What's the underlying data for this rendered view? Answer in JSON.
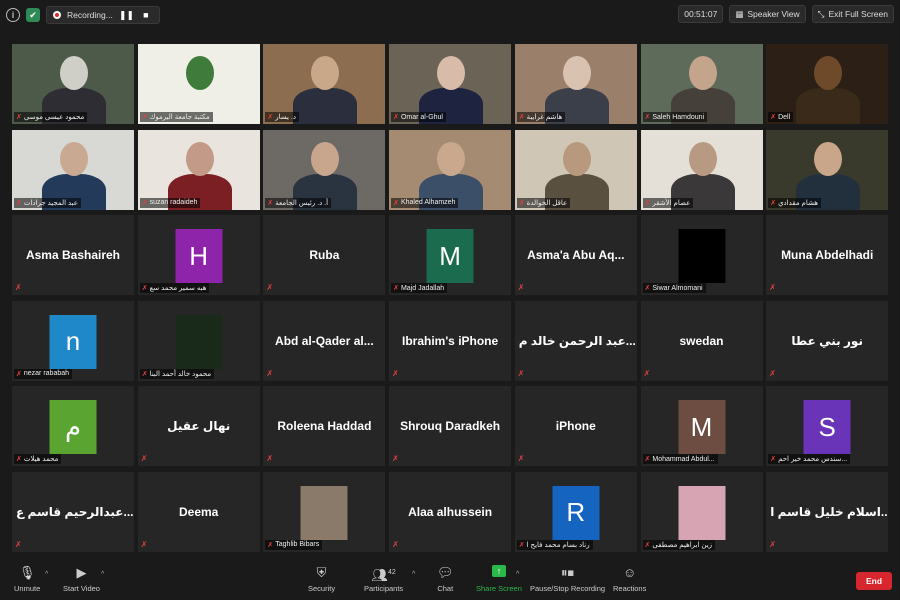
{
  "top_bar": {
    "recording_label": "Recording...",
    "pause_icon": "❚❚",
    "stop_icon": "■",
    "timer": "00:51:07",
    "speaker_view_label": "Speaker View",
    "full_screen_label": "Exit Full Screen"
  },
  "tiles": [
    {
      "type": "video",
      "label": "محمود عيسى موسى"
    },
    {
      "type": "video",
      "label": "مكتبة جامعة اليرموك"
    },
    {
      "type": "video",
      "label": "د. يسار"
    },
    {
      "type": "video",
      "label": "Omar al-Ghul",
      "active": true
    },
    {
      "type": "video",
      "label": "هاشم غرايبة"
    },
    {
      "type": "video",
      "label": "Saleh Hamdouni"
    },
    {
      "type": "video",
      "label": "Dell"
    },
    {
      "type": "video",
      "label": "عبد المجيد جرادات"
    },
    {
      "type": "video",
      "label": "suzan radaideh"
    },
    {
      "type": "video",
      "label": "أ. د. رئيس الجامعة"
    },
    {
      "type": "video",
      "label": "Khaled Alhamzeh"
    },
    {
      "type": "video",
      "label": "عاقل الخوالدة"
    },
    {
      "type": "video",
      "label": "عصام الأشقر"
    },
    {
      "type": "video",
      "label": "هشام مقدادي"
    },
    {
      "type": "name",
      "name": "Asma Bashaireh"
    },
    {
      "type": "letter",
      "letter": "H",
      "color": "#8e24aa",
      "label": "هبه سمير محمد سع"
    },
    {
      "type": "name",
      "name": "Ruba"
    },
    {
      "type": "letter",
      "letter": "M",
      "color": "#1b6b4f",
      "label": "Majd Jadallah"
    },
    {
      "type": "name",
      "name": "Asma'a Abu Aq..."
    },
    {
      "type": "video",
      "label": "Siwar Almomani"
    },
    {
      "type": "name",
      "name": "Muna Abdelhadi"
    },
    {
      "type": "letter",
      "letter": "n",
      "color": "#1e88c8",
      "label": "nezar rababah"
    },
    {
      "type": "video",
      "label": "محمود خالد أحمد البنا"
    },
    {
      "type": "name",
      "name": "Abd al-Qader al..."
    },
    {
      "type": "name",
      "name": "Ibrahim's iPhone"
    },
    {
      "type": "name",
      "name": "عبد الرحمن خالد م..."
    },
    {
      "type": "name",
      "name": "swedan"
    },
    {
      "type": "name",
      "name": "نور بني عطا"
    },
    {
      "type": "letter",
      "letter": "م",
      "color": "#5aa531",
      "label": "محمد هيلات"
    },
    {
      "type": "name",
      "name": "نهال عقيل"
    },
    {
      "type": "name",
      "name": "Roleena Haddad"
    },
    {
      "type": "name",
      "name": "Shrouq Daradkeh"
    },
    {
      "type": "name",
      "name": "iPhone"
    },
    {
      "type": "letter",
      "letter": "M",
      "color": "#6d4c41",
      "label": "Mohammad Abdul..."
    },
    {
      "type": "letter",
      "letter": "S",
      "color": "#6a34b8",
      "label": "سندس محمد خير احم..."
    },
    {
      "type": "name",
      "name": "عبدالرحيم قاسم ع..."
    },
    {
      "type": "name",
      "name": "Deema"
    },
    {
      "type": "video",
      "label": "Taghlib Bibars"
    },
    {
      "type": "name",
      "name": "Alaa alhussein"
    },
    {
      "type": "letter",
      "letter": "R",
      "color": "#1565c0",
      "label": "رناد بسام محمد فايح ا"
    },
    {
      "type": "video",
      "label": "زين ابراهيم مصطفى"
    },
    {
      "type": "name",
      "name": "اسلام خليل قاسم ا..."
    }
  ],
  "toolbar": {
    "unmute": "Unmute",
    "start_video": "Start Video",
    "security": "Security",
    "participants": "Participants",
    "participants_count": "42",
    "chat": "Chat",
    "share_screen": "Share Screen",
    "pause_stop_recording": "Pause/Stop Recording",
    "reactions": "Reactions",
    "end": "End"
  }
}
